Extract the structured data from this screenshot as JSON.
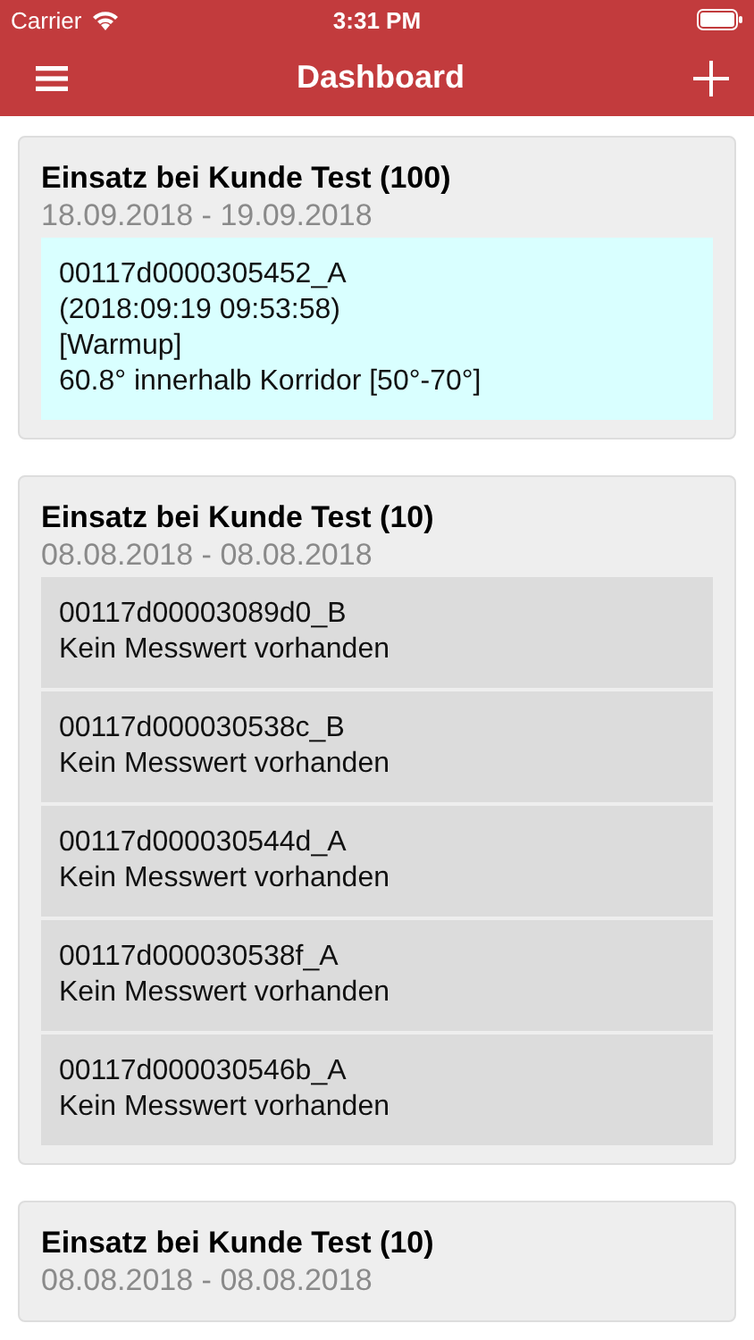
{
  "status_bar": {
    "carrier": "Carrier",
    "time": "3:31 PM"
  },
  "nav": {
    "title": "Dashboard"
  },
  "cards": [
    {
      "title": "Einsatz bei Kunde Test (100)",
      "dates": "18.09.2018 - 19.09.2018",
      "items": [
        {
          "kind": "reading",
          "lines": [
            "00117d0000305452_A",
            "(2018:09:19 09:53:58)",
            "[Warmup]",
            "60.8° innerhalb Korridor [50°-70°]"
          ]
        }
      ]
    },
    {
      "title": "Einsatz bei Kunde Test (10)",
      "dates": "08.08.2018 - 08.08.2018",
      "items": [
        {
          "kind": "empty",
          "lines": [
            "00117d00003089d0_B",
            "Kein Messwert vorhanden"
          ]
        },
        {
          "kind": "empty",
          "lines": [
            "00117d000030538c_B",
            "Kein Messwert vorhanden"
          ]
        },
        {
          "kind": "empty",
          "lines": [
            "00117d000030544d_A",
            "Kein Messwert vorhanden"
          ]
        },
        {
          "kind": "empty",
          "lines": [
            "00117d000030538f_A",
            "Kein Messwert vorhanden"
          ]
        },
        {
          "kind": "empty",
          "lines": [
            "00117d000030546b_A",
            "Kein Messwert vorhanden"
          ]
        }
      ]
    },
    {
      "title": "Einsatz bei Kunde Test (10)",
      "dates": "08.08.2018 - 08.08.2018"
    }
  ]
}
